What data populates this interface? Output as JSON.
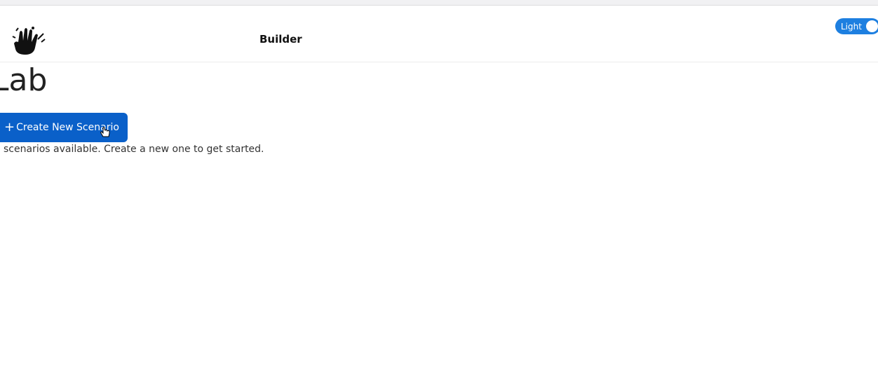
{
  "header": {
    "logo_icon": "hand-logo-icon",
    "nav_link_label": "Builder",
    "theme_toggle_label": "Light",
    "accent_color": "#1d7fe0"
  },
  "main": {
    "title": "Lab",
    "create_button_label": "Create New Scenario",
    "create_button_icon": "plus-icon",
    "create_button_color": "#0a60c9",
    "empty_message": "o scenarios available. Create a new one to get started."
  }
}
